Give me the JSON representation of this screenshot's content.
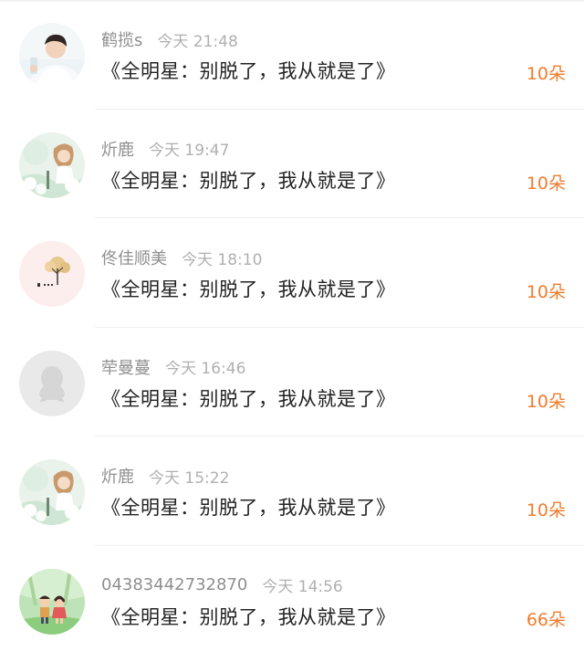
{
  "items": [
    {
      "name": "鹤揽s",
      "time": "今天 21:48",
      "title": "《全明星：别脱了，我从就是了》",
      "count": "10朵",
      "avatar_icon": "user-photo-avatar"
    },
    {
      "name": "炘鹿",
      "time": "今天 19:47",
      "title": "《全明星：别脱了，我从就是了》",
      "count": "10朵",
      "avatar_icon": "anime-girl-avatar"
    },
    {
      "name": "佟佳顺美",
      "time": "今天 18:10",
      "title": "《全明星：别脱了，我从就是了》",
      "count": "10朵",
      "avatar_icon": "tree-avatar"
    },
    {
      "name": "荦曼蔓",
      "time": "今天 16:46",
      "title": "《全明星：别脱了，我从就是了》",
      "count": "10朵",
      "avatar_icon": "default-penguin-avatar"
    },
    {
      "name": "炘鹿",
      "time": "今天 15:22",
      "title": "《全明星：别脱了，我从就是了》",
      "count": "10朵",
      "avatar_icon": "anime-girl-avatar"
    },
    {
      "name": "04383442732870",
      "time": "今天 14:56",
      "title": "《全明星：别脱了，我从就是了》",
      "count": "66朵",
      "avatar_icon": "cartoon-couple-avatar"
    }
  ],
  "colors": {
    "accent": "#f07c2d",
    "name_text": "#8f8f8f",
    "time_text": "#b0b0b0",
    "title_text": "#222222"
  }
}
